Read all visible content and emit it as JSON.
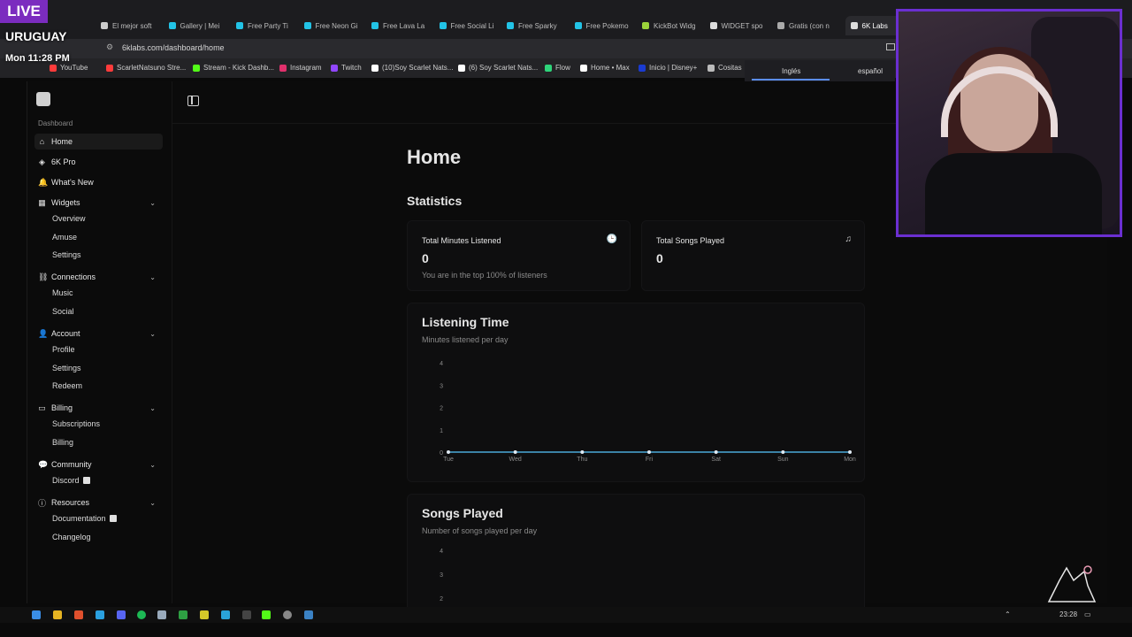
{
  "overlay": {
    "live_label": "LIVE",
    "country": "URUGUAY",
    "datetime": "Mon 11:28 PM"
  },
  "browser": {
    "tabs": [
      {
        "label": "El mejor soft",
        "color": "#cccccc"
      },
      {
        "label": "Gallery | Mei",
        "color": "#22c3e6"
      },
      {
        "label": "Free Party Ti",
        "color": "#22c3e6"
      },
      {
        "label": "Free Neon Gi",
        "color": "#22c3e6"
      },
      {
        "label": "Free Lava La",
        "color": "#22c3e6"
      },
      {
        "label": "Free Social Li",
        "color": "#22c3e6"
      },
      {
        "label": "Free Sparky",
        "color": "#22c3e6"
      },
      {
        "label": "Free Pokemo",
        "color": "#22c3e6"
      },
      {
        "label": "KickBot Widg",
        "color": "#9bd33a"
      },
      {
        "label": "WIDGET spo",
        "color": "#dddddd"
      },
      {
        "label": "Gratis (con n",
        "color": "#aaaaaa"
      },
      {
        "label": "6K Labs",
        "color": "#dddddd"
      }
    ],
    "tab_close": "×",
    "url": "6klabs.com/dashboard/home",
    "bookmarks": [
      {
        "label": "YouTube",
        "color": "#ff3b3b"
      },
      {
        "label": "ScarletNatsuno Stre...",
        "color": "#ff3b3b"
      },
      {
        "label": "Stream - Kick Dashb...",
        "color": "#53fc18"
      },
      {
        "label": "Instagram",
        "color": "#e1306c"
      },
      {
        "label": "Twitch",
        "color": "#9146ff"
      },
      {
        "label": "(10)Soy Scarlet Nats...",
        "color": "#ffffff"
      },
      {
        "label": "(6) Soy Scarlet Nats...",
        "color": "#ffffff"
      },
      {
        "label": "Flow",
        "color": "#2ed47a"
      },
      {
        "label": "Home • Max",
        "color": "#ffffff"
      },
      {
        "label": "Inicio | Disney+",
        "color": "#1a3bd1"
      },
      {
        "label": "Cositas",
        "color": "#bbbbbb"
      }
    ],
    "translate": {
      "lang1": "Inglés",
      "lang2": "español"
    }
  },
  "sidebar": {
    "section_label": "Dashboard",
    "items": [
      {
        "label": "Home",
        "icon": "home-icon",
        "glyph": "⌂"
      },
      {
        "label": "6K Pro",
        "icon": "gem-icon",
        "glyph": "◈"
      },
      {
        "label": "What's New",
        "icon": "bell-icon",
        "glyph": "🔔"
      },
      {
        "label": "Widgets",
        "icon": "grid-icon",
        "glyph": "▦",
        "children": [
          "Overview",
          "Amuse",
          "Settings"
        ]
      },
      {
        "label": "Connections",
        "icon": "link-icon",
        "glyph": "⛓",
        "children": [
          "Music",
          "Social"
        ]
      },
      {
        "label": "Account",
        "icon": "user-icon",
        "glyph": "👤",
        "children": [
          "Profile",
          "Settings",
          "Redeem"
        ]
      },
      {
        "label": "Billing",
        "icon": "card-icon",
        "glyph": "▭",
        "children": [
          "Subscriptions",
          "Billing"
        ]
      },
      {
        "label": "Community",
        "icon": "chat-icon",
        "glyph": "💬",
        "children": [
          "Discord"
        ]
      },
      {
        "label": "Resources",
        "icon": "info-icon",
        "glyph": "ⓘ",
        "children": [
          "Documentation",
          "Changelog"
        ]
      }
    ],
    "chevron": "⌄"
  },
  "main": {
    "page_title": "Home",
    "statistics_title": "Statistics",
    "stats": [
      {
        "title": "Total Minutes Listened",
        "value": "0",
        "sub": "You are in the top 100% of listeners",
        "icon": "clock-icon",
        "glyph": "🕒"
      },
      {
        "title": "Total Songs Played",
        "value": "0",
        "sub": "",
        "icon": "music-icon",
        "glyph": "♫"
      }
    ],
    "listening": {
      "title": "Listening Time",
      "subtitle": "Minutes listened per day"
    },
    "songs": {
      "title": "Songs Played",
      "subtitle": "Number of songs played per day"
    }
  },
  "chart_data": [
    {
      "type": "line",
      "title": "Listening Time",
      "subtitle": "Minutes listened per day",
      "categories": [
        "Tue",
        "Wed",
        "Thu",
        "Fri",
        "Sat",
        "Sun",
        "Mon"
      ],
      "values": [
        0,
        0,
        0,
        0,
        0,
        0,
        0
      ],
      "yticks": [
        0,
        1,
        2,
        3,
        4
      ],
      "ylim": [
        0,
        4
      ],
      "color": "#4aa8d8"
    },
    {
      "type": "line",
      "title": "Songs Played",
      "subtitle": "Number of songs played per day",
      "yticks": [
        2,
        3,
        4
      ],
      "ylim": [
        0,
        4
      ]
    }
  ],
  "taskbar": {
    "clock": "23:28"
  }
}
